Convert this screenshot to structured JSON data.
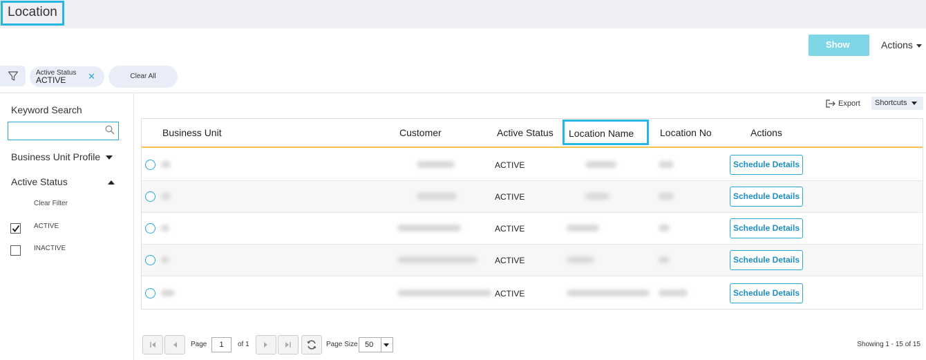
{
  "page": {
    "title": "Location"
  },
  "toolbar": {
    "show_label": "Show",
    "actions_label": "Actions"
  },
  "filters": {
    "chip": {
      "label": "Active Status",
      "value": "ACTIVE",
      "remove_icon": "close-icon"
    },
    "clear_all_label": "Clear All"
  },
  "sidebar": {
    "keyword_label": "Keyword Search",
    "keyword_value": "",
    "business_unit_profile_label": "Business Unit Profile",
    "active_status_label": "Active Status",
    "clear_filter_label": "Clear Filter",
    "options": [
      {
        "label": "ACTIVE",
        "checked": true
      },
      {
        "label": "INACTIVE",
        "checked": false
      }
    ]
  },
  "grid_toolbar": {
    "export_label": "Export",
    "shortcuts_label": "Shortcuts"
  },
  "table": {
    "columns": [
      "Business Unit",
      "Customer",
      "Active Status",
      "Location Name",
      "Location No",
      "Actions"
    ],
    "rows": [
      {
        "active_status": "ACTIVE",
        "action": "Schedule Details"
      },
      {
        "active_status": "ACTIVE",
        "action": "Schedule Details"
      },
      {
        "active_status": "ACTIVE",
        "action": "Schedule Details"
      },
      {
        "active_status": "ACTIVE",
        "action": "Schedule Details"
      },
      {
        "active_status": "ACTIVE",
        "action": "Schedule Details"
      }
    ]
  },
  "pagination": {
    "page_label": "Page",
    "current_page": "1",
    "of_label": "of 1",
    "page_size_label": "Page Size",
    "page_size": "50",
    "showing": "Showing 1 - 15 of 15"
  },
  "colors": {
    "accent": "#27b5e6",
    "show_button": "#7fd6e6",
    "header_underline": "#f5c04b",
    "chip_bg": "#e8edf8"
  }
}
